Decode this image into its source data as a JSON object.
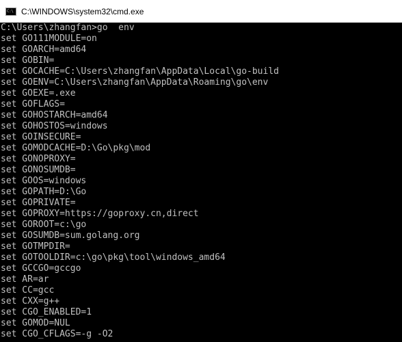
{
  "window": {
    "icon_glyph": "C:\\",
    "title": "C:\\WINDOWS\\system32\\cmd.exe"
  },
  "console": {
    "lines": [
      "C:\\Users\\zhangfan>go  env",
      "set GO111MODULE=on",
      "set GOARCH=amd64",
      "set GOBIN=",
      "set GOCACHE=C:\\Users\\zhangfan\\AppData\\Local\\go-build",
      "set GOENV=C:\\Users\\zhangfan\\AppData\\Roaming\\go\\env",
      "set GOEXE=.exe",
      "set GOFLAGS=",
      "set GOHOSTARCH=amd64",
      "set GOHOSTOS=windows",
      "set GOINSECURE=",
      "set GOMODCACHE=D:\\Go\\pkg\\mod",
      "set GONOPROXY=",
      "set GONOSUMDB=",
      "set GOOS=windows",
      "set GOPATH=D:\\Go",
      "set GOPRIVATE=",
      "set GOPROXY=https://goproxy.cn,direct",
      "set GOROOT=c:\\go",
      "set GOSUMDB=sum.golang.org",
      "set GOTMPDIR=",
      "set GOTOOLDIR=c:\\go\\pkg\\tool\\windows_amd64",
      "set GCCGO=gccgo",
      "set AR=ar",
      "set CC=gcc",
      "set CXX=g++",
      "set CGO_ENABLED=1",
      "set GOMOD=NUL",
      "set CGO_CFLAGS=-g -O2"
    ]
  },
  "colors": {
    "console_background": "#000000",
    "console_text": "#c0c0c0",
    "titlebar_background": "#ffffff"
  }
}
